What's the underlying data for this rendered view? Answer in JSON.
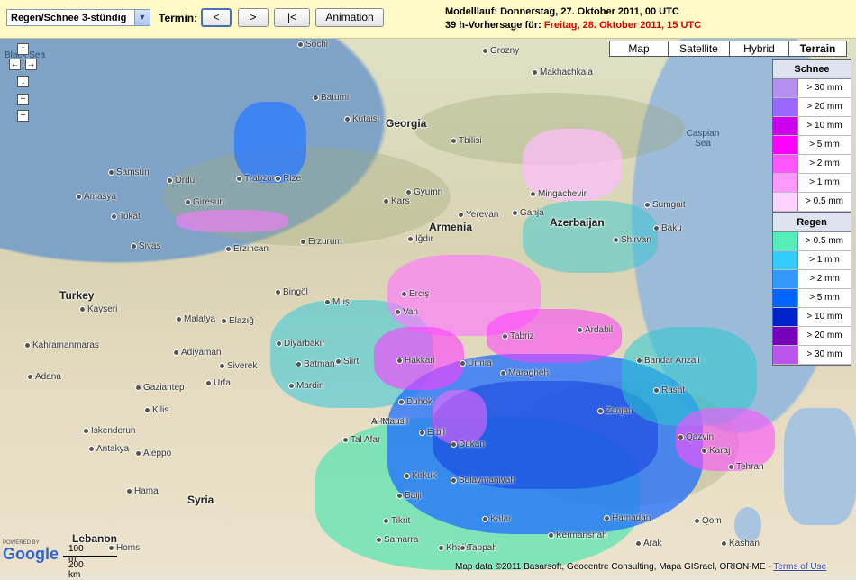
{
  "toolbar": {
    "select_value": "Regen/Schnee 3-stündig",
    "termin_label": "Termin:",
    "btn_prev": "<",
    "btn_next": ">",
    "btn_first": "|<",
    "btn_animation": "Animation",
    "modelllauf": "Modelllauf: Donnerstag, 27. Oktober 2011, 00 UTC",
    "vorhersage_prefix": "39 h-Vorhersage für: ",
    "vorhersage_date": "Freitag, 28. Oktober 2011, 15 UTC"
  },
  "map_controls": {
    "pan_up": "↑",
    "pan_left": "←",
    "pan_right": "→",
    "pan_down": "↓",
    "zoom_in": "+",
    "zoom_out": "−"
  },
  "map_types": [
    "Map",
    "Satellite",
    "Hybrid",
    "Terrain"
  ],
  "selected_map_type": "Terrain",
  "legend": {
    "snow_title": "Schnee",
    "snow": [
      {
        "label": "> 30 mm",
        "color": "#b58ff0"
      },
      {
        "label": "> 20 mm",
        "color": "#9966ff"
      },
      {
        "label": "> 10 mm",
        "color": "#cc00ee"
      },
      {
        "label": "> 5 mm",
        "color": "#ff00ff"
      },
      {
        "label": "> 2 mm",
        "color": "#ff55ff"
      },
      {
        "label": "> 1 mm",
        "color": "#ff99ff"
      },
      {
        "label": "> 0.5 mm",
        "color": "#ffd2ff"
      }
    ],
    "rain_title": "Regen",
    "rain": [
      {
        "label": "> 0.5 mm",
        "color": "#55eebb"
      },
      {
        "label": "> 1 mm",
        "color": "#33ccff"
      },
      {
        "label": "> 2 mm",
        "color": "#3399ff"
      },
      {
        "label": "> 5 mm",
        "color": "#0066ff"
      },
      {
        "label": "> 10 mm",
        "color": "#0022cc"
      },
      {
        "label": "> 20 mm",
        "color": "#7700bb"
      },
      {
        "label": "> 30 mm",
        "color": "#bb55ee"
      }
    ]
  },
  "countries": [
    "Georgia",
    "Armenia",
    "Azerbaijan",
    "Turkey",
    "Syria",
    "Lebanon"
  ],
  "seas": [
    "Black Sea",
    "Caspian Sea"
  ],
  "cities": [
    "Sochi",
    "Grozny",
    "Makhachkala",
    "Batumi",
    "Kutaisi",
    "Tbilisi",
    "Samsun",
    "Trabzon",
    "Rize",
    "Ordu",
    "Giresun",
    "Amasya",
    "Tokat",
    "Sivas",
    "Erzincan",
    "Erzurum",
    "Kars",
    "Gyumri",
    "Yerevan",
    "Ganja",
    "Mingachevir",
    "Sumgait",
    "Baku",
    "Shirvan",
    "Iğdır",
    "Van",
    "Erciş",
    "Muş",
    "Bingöl",
    "Kayseri",
    "Malatya",
    "Elazığ",
    "Diyarbakır",
    "Batman",
    "Siirt",
    "Mardin",
    "Urfa",
    "Gaziantep",
    "Adana",
    "Hakkari",
    "Urmia",
    "Tabriz",
    "Maragheh",
    "Ardabil",
    "Bandar Anzali",
    "Rasht",
    "Qazvin",
    "Karaj",
    "Tehran",
    "Zanjan",
    "Hamadan",
    "Erbil",
    "Mosul",
    "Duhok",
    "Kirkuk",
    "Sulaymaniyah",
    "Tal Afar",
    "Tikrit",
    "Samarra",
    "Baiji",
    "Aleppo",
    "Homs",
    "Khalis",
    "Kashan",
    "Qom",
    "Arak",
    "Kermanshah",
    "Adiyaman",
    "Siverek",
    "Kahramanmaras",
    "Kilis",
    "Iskenderun",
    "Antakya",
    "Hama",
    "Al-Mausil",
    "Dukan",
    "Kalar",
    "Tappah"
  ],
  "scale": {
    "top": "100 mi",
    "bottom": "200 km"
  },
  "google_logo": "Google",
  "powered_by": "POWERED BY",
  "copyright": {
    "text": "Map data ©2011 Basarsoft, Geocentre Consulting, Mapa GISrael, ORION-ME - ",
    "link": "Terms of Use"
  }
}
